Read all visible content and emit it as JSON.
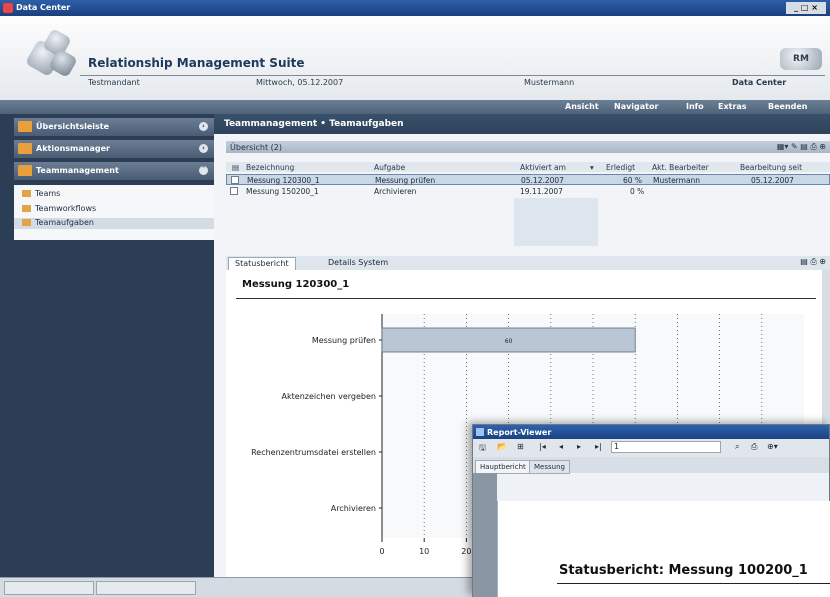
{
  "window": {
    "title": "Data Center"
  },
  "banner": {
    "suite_title": "Relationship Management Suite",
    "client": "Testmandant",
    "date": "Mittwoch, 05.12.2007",
    "user": "Mustermann",
    "module": "Data Center",
    "logo_text": "RM"
  },
  "menu": [
    "Ansicht",
    "Navigator",
    "Info",
    "Extras",
    "Beenden"
  ],
  "sidebar": {
    "sections": [
      {
        "label": "Übersichtsleiste"
      },
      {
        "label": "Aktionsmanager"
      },
      {
        "label": "Teammanagement"
      }
    ],
    "items": [
      {
        "label": "Teams"
      },
      {
        "label": "Teamworkflows"
      },
      {
        "label": "Teamaufgaben"
      }
    ]
  },
  "breadcrumb": "Teammanagement • Teamaufgaben",
  "overview": {
    "title": "Übersicht (2)",
    "columns": [
      "Bezeichnung",
      "Aufgabe",
      "Aktiviert am",
      "Erledigt",
      "Akt. Bearbeiter",
      "Bearbeitung seit"
    ],
    "rows": [
      {
        "bezeichnung": "Messung 120300_1",
        "aufgabe": "Messung prüfen",
        "aktiviert": "05.12.2007",
        "erledigt": "60 %",
        "bearbeiter": "Mustermann",
        "seit": "05.12.2007"
      },
      {
        "bezeichnung": "Messung 150200_1",
        "aufgabe": "Archivieren",
        "aktiviert": "19.11.2007",
        "erledigt": "0 %",
        "bearbeiter": "",
        "seit": ""
      }
    ]
  },
  "detail_tabs": [
    "Statusbericht",
    "Details System"
  ],
  "report": {
    "title": "Messung 120300_1"
  },
  "chart_data": {
    "type": "bar",
    "orientation": "horizontal",
    "categories": [
      "Messung prüfen",
      "Aktenzeichen vergeben",
      "Rechenzentrumsdatei erstellen",
      "Archivieren"
    ],
    "values": [
      60,
      0,
      0,
      0
    ],
    "data_labels": [
      "60",
      "",
      "",
      ""
    ],
    "x_ticks": [
      "0",
      "10",
      "20"
    ],
    "xlim": [
      0,
      100
    ],
    "grid": true
  },
  "viewer": {
    "title": "Report-Viewer",
    "page_field": "1",
    "tabs": [
      "Hauptbericht",
      "Messung"
    ],
    "heading": "Statusbericht: Messung 100200_1"
  }
}
